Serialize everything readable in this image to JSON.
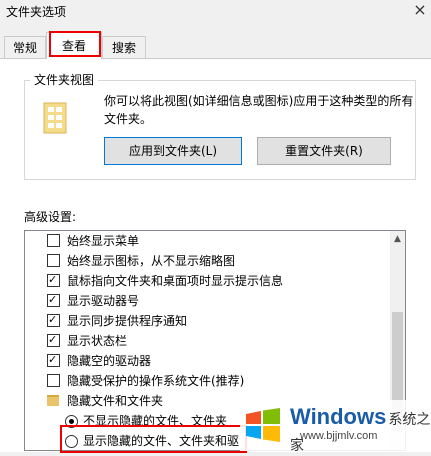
{
  "window": {
    "title": "文件夹选项",
    "close": "×"
  },
  "tabs": [
    {
      "label": "常规"
    },
    {
      "label": "查看"
    },
    {
      "label": "搜索"
    }
  ],
  "folder_views": {
    "label": "文件夹视图",
    "description": "你可以将此视图(如详细信息或图标)应用于这种类型的所有文件夹。",
    "apply_button": "应用到文件夹(L)",
    "reset_button": "重置文件夹(R)"
  },
  "advanced": {
    "label": "高级设置:",
    "items": [
      {
        "type": "checkbox",
        "checked": false,
        "label": "始终显示菜单"
      },
      {
        "type": "checkbox",
        "checked": false,
        "label": "始终显示图标，从不显示缩略图"
      },
      {
        "type": "checkbox",
        "checked": true,
        "label": "鼠标指向文件夹和桌面项时显示提示信息"
      },
      {
        "type": "checkbox",
        "checked": true,
        "label": "显示驱动器号"
      },
      {
        "type": "checkbox",
        "checked": true,
        "label": "显示同步提供程序通知"
      },
      {
        "type": "checkbox",
        "checked": true,
        "label": "显示状态栏"
      },
      {
        "type": "checkbox",
        "checked": true,
        "label": "隐藏空的驱动器"
      },
      {
        "type": "checkbox",
        "checked": false,
        "label": "隐藏受保护的操作系统文件(推荐)"
      },
      {
        "type": "folder",
        "label": "隐藏文件和文件夹"
      },
      {
        "type": "radio",
        "checked": true,
        "label": "不显示隐藏的文件、文件夹"
      },
      {
        "type": "radio",
        "checked": false,
        "label": "显示隐藏的文件、文件夹和驱"
      }
    ]
  },
  "watermark": {
    "brand": "Windows",
    "suffix": "系统之家",
    "url": "www.bjjmlv.com"
  },
  "colors": {
    "highlight": "#e00000",
    "accent": "#0078d7"
  }
}
